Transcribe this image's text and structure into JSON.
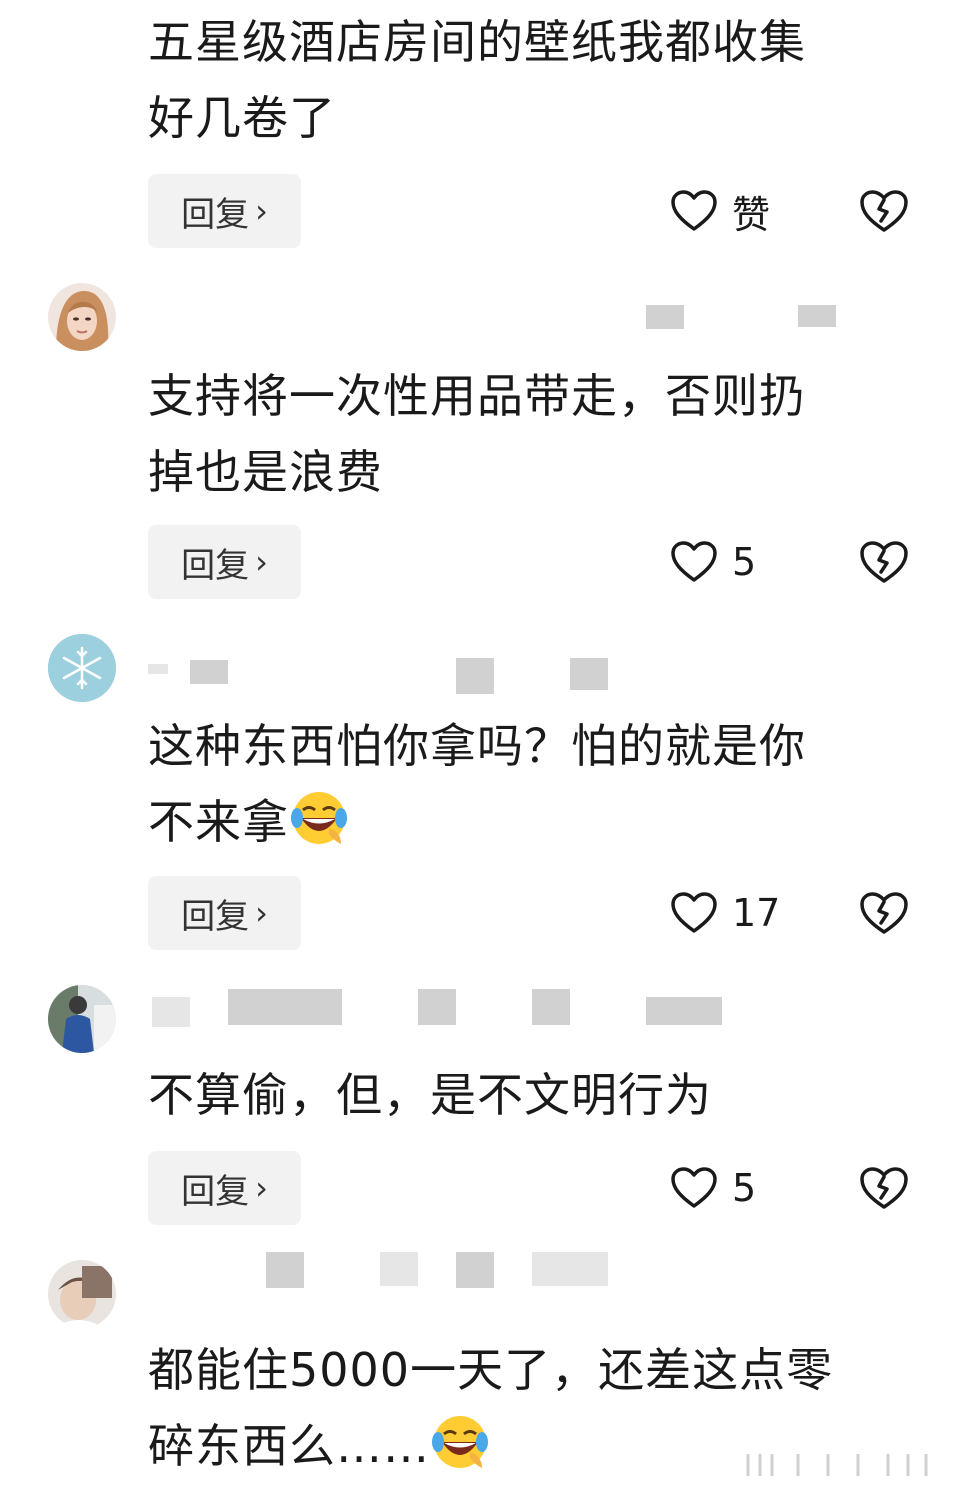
{
  "comments": [
    {
      "text_lines": [
        "五星级酒店房间的壁纸我都收集",
        "好几卷了"
      ],
      "emoji": null,
      "reply_label": "回复",
      "like_label": "赞",
      "avatar": null
    },
    {
      "text_lines": [
        "支持将一次性用品带走，否则扔",
        "掉也是浪费"
      ],
      "emoji": null,
      "reply_label": "回复",
      "like_label": "5",
      "avatar": "woman-portrait"
    },
    {
      "text_lines": [
        "这种东西怕你拿吗？怕的就是你",
        "不来拿"
      ],
      "emoji": "rofl-emoji",
      "reply_label": "回复",
      "like_label": "17",
      "avatar": "snowflake"
    },
    {
      "text_lines": [
        "不算偷，但，是不文明行为"
      ],
      "emoji": null,
      "reply_label": "回复",
      "like_label": "5",
      "avatar": "person-photo"
    },
    {
      "text_lines": [
        "都能住5000一天了，还差这点零",
        "碎东西么……"
      ],
      "emoji": "rofl-emoji",
      "reply_label": null,
      "like_label": null,
      "avatar": "child-photo"
    }
  ],
  "icons": {
    "like": "heart-outline-icon",
    "dislike": "broken-heart-icon",
    "reply_chevron": "chevron-right-icon"
  },
  "colors": {
    "background": "#ffffff",
    "text": "#1a1a1a",
    "reply_bg": "#f2f2f2"
  }
}
